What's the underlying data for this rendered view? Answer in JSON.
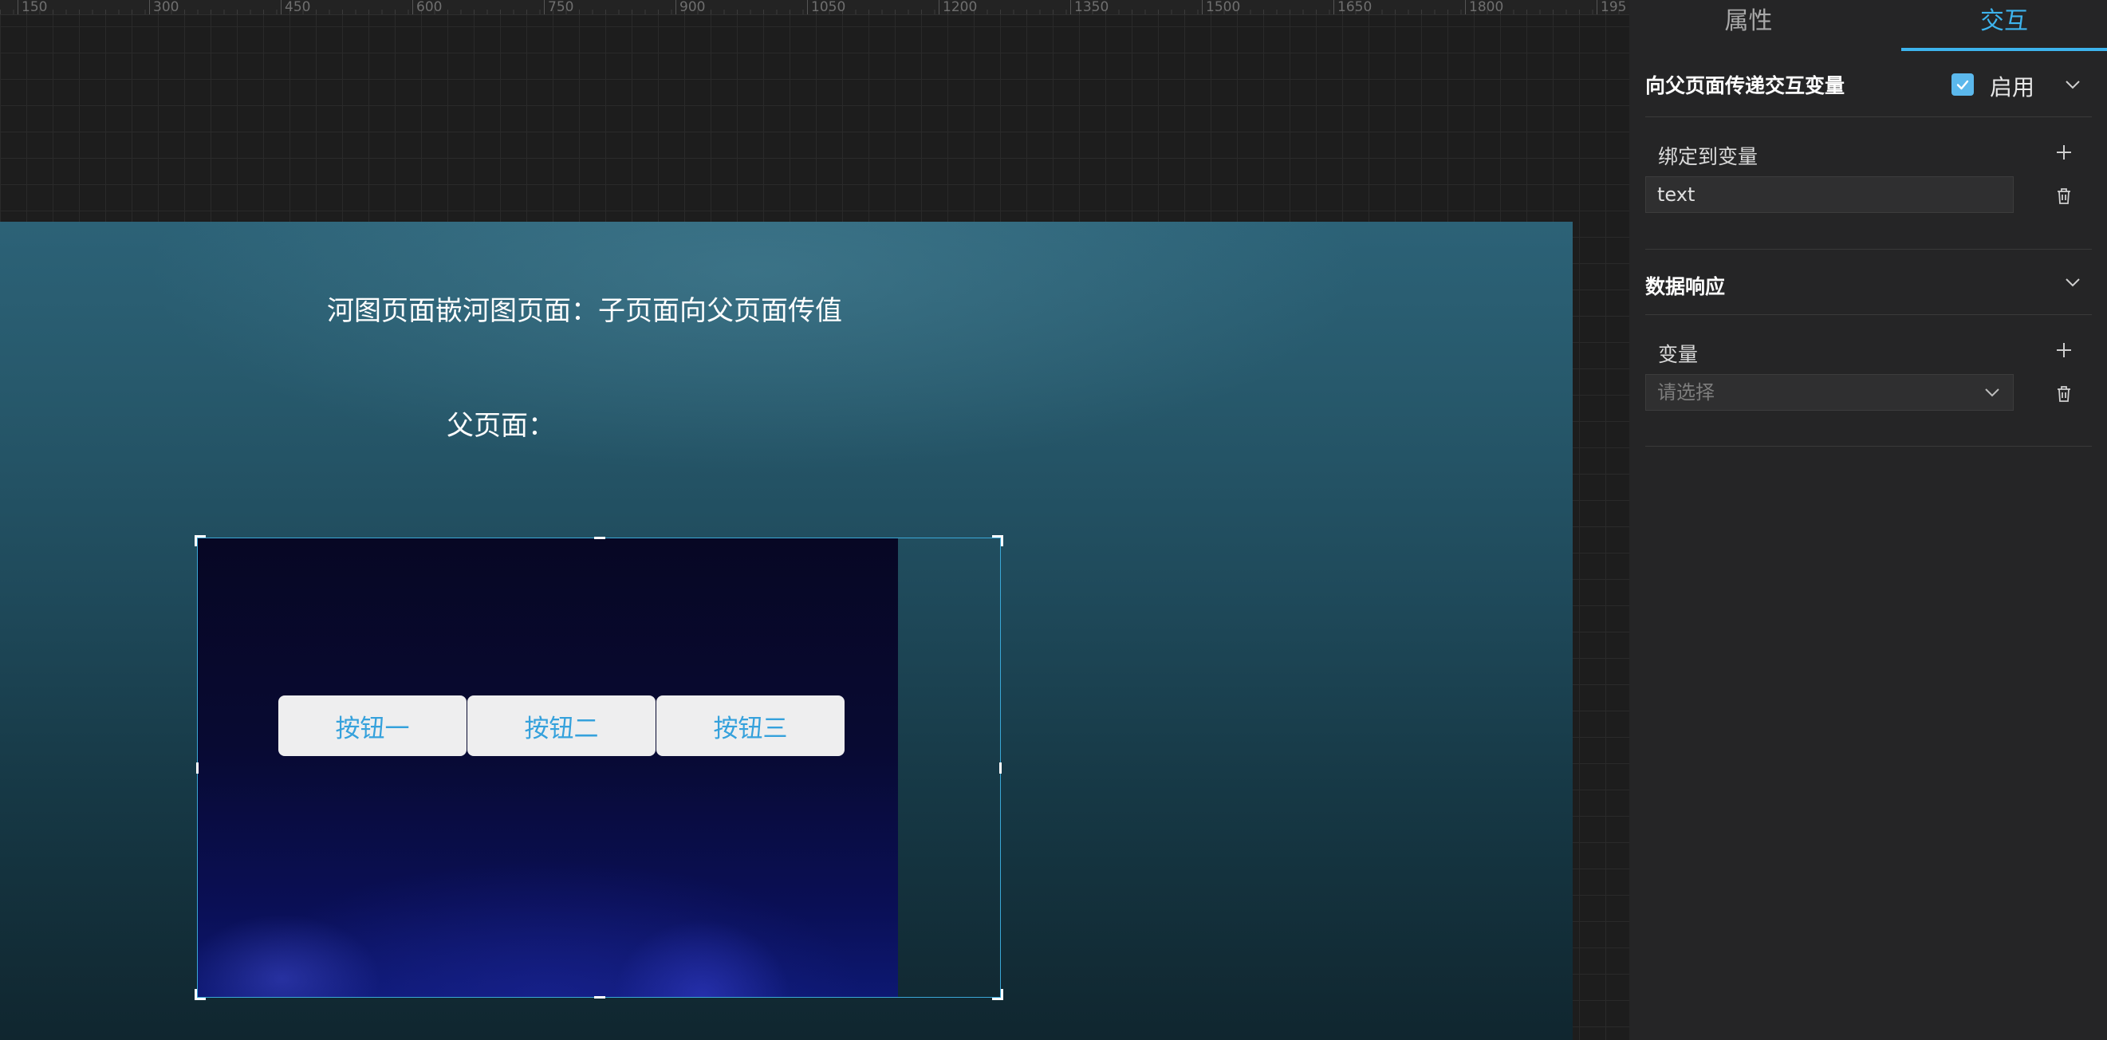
{
  "ruler": {
    "ticks": [
      "150",
      "300",
      "450",
      "600",
      "750",
      "900",
      "1050",
      "1200",
      "1350",
      "1500",
      "1650",
      "1800",
      "195"
    ]
  },
  "canvas": {
    "page_title": "河图页面嵌河图页面：子页面向父页面传值",
    "parent_label": "父页面：",
    "child_buttons": [
      "按钮一",
      "按钮二",
      "按钮三"
    ]
  },
  "panel": {
    "tabs": [
      {
        "label": "属性",
        "active": false
      },
      {
        "label": "交互",
        "active": true
      }
    ],
    "pass_section": {
      "title": "向父页面传递交互变量",
      "enable_label": "启用",
      "enabled": true,
      "bind_label": "绑定到变量",
      "bind_value": "text"
    },
    "response_section": {
      "title": "数据响应",
      "variable_label": "变量",
      "select_placeholder": "请选择"
    }
  },
  "colors": {
    "accent": "#3db4ee",
    "button_text": "#35a1dc",
    "frame_border": "#3aa7d6"
  }
}
